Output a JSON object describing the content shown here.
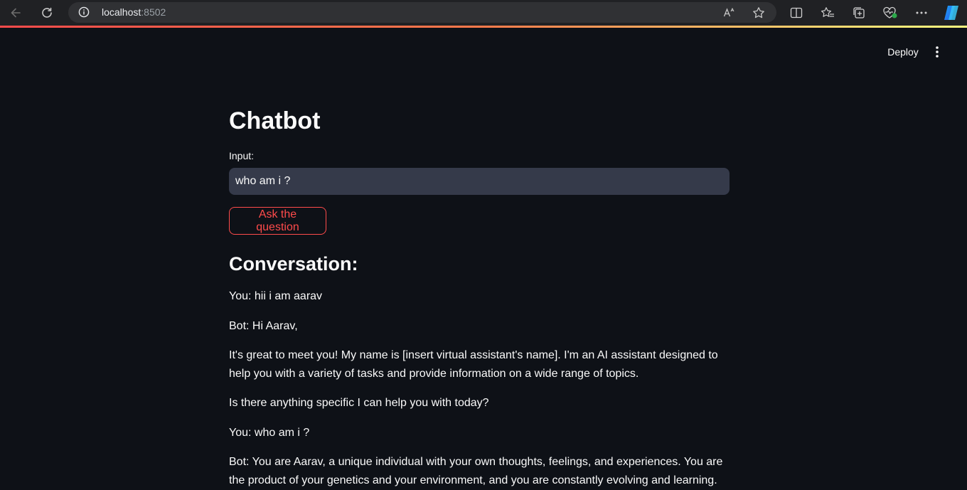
{
  "browser": {
    "url_host": "localhost",
    "url_port": ":8502"
  },
  "header": {
    "deploy_label": "Deploy"
  },
  "main": {
    "title": "Chatbot",
    "input_label": "Input:",
    "input_value": "who am i ?",
    "ask_button_label": "Ask the question",
    "conversation_heading": "Conversation:",
    "messages": [
      "You: hii i am aarav",
      "Bot: Hi Aarav,",
      "It's great to meet you! My name is [insert virtual assistant's name]. I'm an AI assistant designed to help you with a variety of tasks and provide information on a wide range of topics.",
      "Is there anything specific I can help you with today?",
      "You: who am i ?",
      "Bot: You are Aarav, a unique individual with your own thoughts, feelings, and experiences. You are the product of your genetics and your environment, and you are constantly evolving and learning."
    ]
  },
  "colors": {
    "background": "#0e1117",
    "accent": "#ff4b4b",
    "input_background": "#353a4a"
  }
}
